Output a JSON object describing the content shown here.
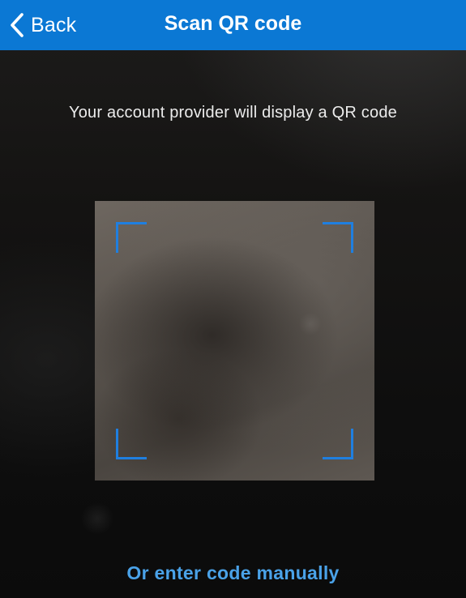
{
  "navbar": {
    "back_label": "Back",
    "back_icon": "chevron-left-icon",
    "title": "Scan QR code",
    "background_color": "#0b78d4"
  },
  "main": {
    "instruction": "Your account provider will display a QR code",
    "scanner": {
      "frame_color": "#1f7fe0"
    },
    "manual_entry_label": "Or enter code manually",
    "link_color": "#4aa2e8"
  }
}
